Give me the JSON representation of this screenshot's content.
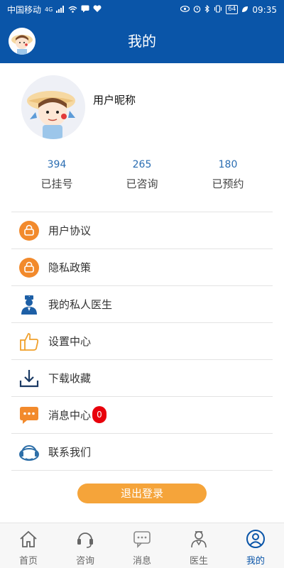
{
  "status_bar": {
    "carrier": "中国移动",
    "network": "4G",
    "battery": "64",
    "time": "09:35"
  },
  "header": {
    "title": "我的"
  },
  "profile": {
    "nickname": "用户昵称"
  },
  "stats": [
    {
      "value": "394",
      "label": "已挂号"
    },
    {
      "value": "265",
      "label": "已咨询"
    },
    {
      "value": "180",
      "label": "已预约"
    }
  ],
  "menu": [
    {
      "label": "用户协议",
      "icon": "lock-icon"
    },
    {
      "label": "隐私政策",
      "icon": "lock-icon"
    },
    {
      "label": "我的私人医生",
      "icon": "doctor-icon"
    },
    {
      "label": "设置中心",
      "icon": "thumbs-up-icon"
    },
    {
      "label": "下载收藏",
      "icon": "download-icon"
    },
    {
      "label": "消息中心",
      "icon": "message-icon",
      "badge": "0"
    },
    {
      "label": "联系我们",
      "icon": "headset-icon"
    }
  ],
  "logout_label": "退出登录",
  "tabs": [
    {
      "label": "首页",
      "icon": "home-icon"
    },
    {
      "label": "咨询",
      "icon": "headset-icon"
    },
    {
      "label": "消息",
      "icon": "chat-icon"
    },
    {
      "label": "医生",
      "icon": "doctor-icon"
    },
    {
      "label": "我的",
      "icon": "user-icon",
      "active": true
    }
  ],
  "colors": {
    "primary": "#0a55a8",
    "accent": "#f5a43a",
    "badge": "#e8000b"
  }
}
